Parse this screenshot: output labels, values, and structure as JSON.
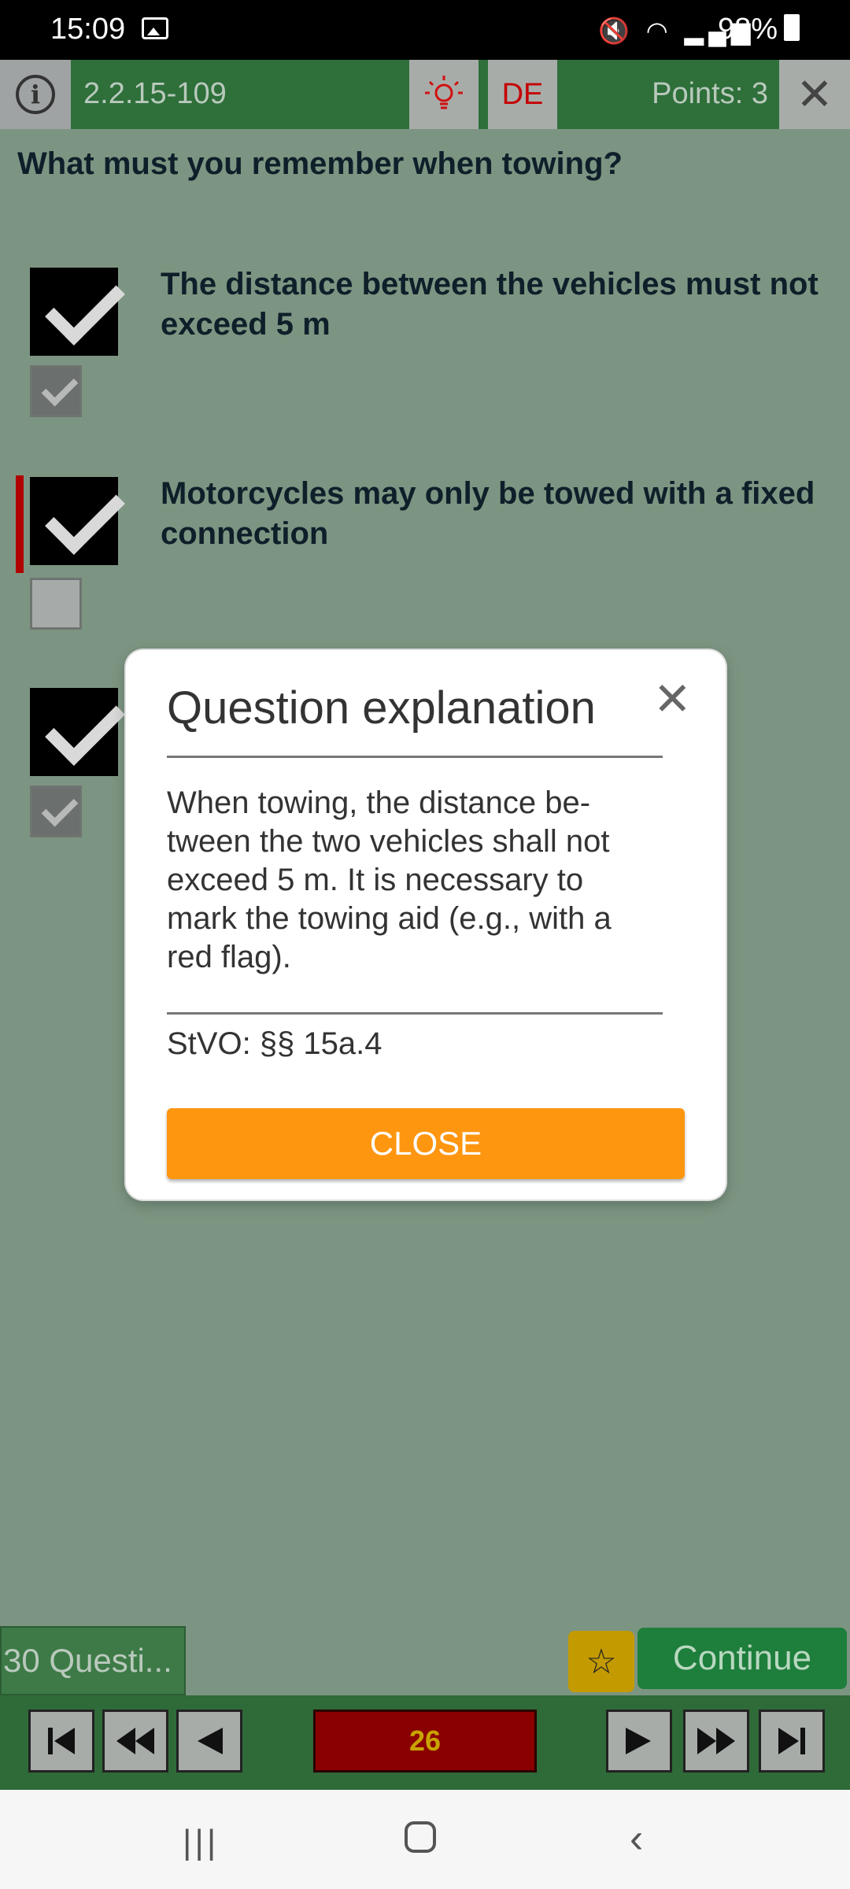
{
  "status_bar": {
    "time": "15:09",
    "battery": "98%",
    "icons": [
      "image-icon",
      "mute-icon",
      "wifi-icon",
      "signal-icon",
      "battery-icon"
    ]
  },
  "top_bar": {
    "question_id": "2.2.15-109",
    "hint_icon": "lightbulb-icon",
    "language": "DE",
    "points": "Points: 3",
    "close_icon": "close-icon"
  },
  "question": {
    "text": "What must you remember when towing?"
  },
  "answers": [
    {
      "text": "The distance between the vehicles must not exceed 5 m",
      "correct": true,
      "user_checked": true,
      "wrong_marker": false
    },
    {
      "text": "Motorcycles may only be towed with a fixed connection",
      "correct": true,
      "user_checked": false,
      "wrong_marker": true
    },
    {
      "text": "",
      "correct": true,
      "user_checked": true,
      "wrong_marker": false
    }
  ],
  "dialog": {
    "title": "Question explanation",
    "body": "When towing, the distance be-tween the two vehicles shall not exceed 5 m. It is necessary to mark the towing aid (e.g., with a red flag).",
    "reference": "StVO: §§ 15a.4",
    "close_label": "CLOSE"
  },
  "bottom": {
    "question_count": "30 Questi...",
    "continue_label": "Continue"
  },
  "navigation": {
    "current": "26",
    "buttons": [
      "first-icon",
      "rewind-icon",
      "previous-icon",
      "next-icon",
      "fast-forward-icon",
      "last-icon"
    ]
  },
  "colors": {
    "background": "#7c9582",
    "header": "#2e6f3a",
    "accent": "#ff9610",
    "continue": "#1e7e3c",
    "counter_bg": "#8a0000"
  }
}
